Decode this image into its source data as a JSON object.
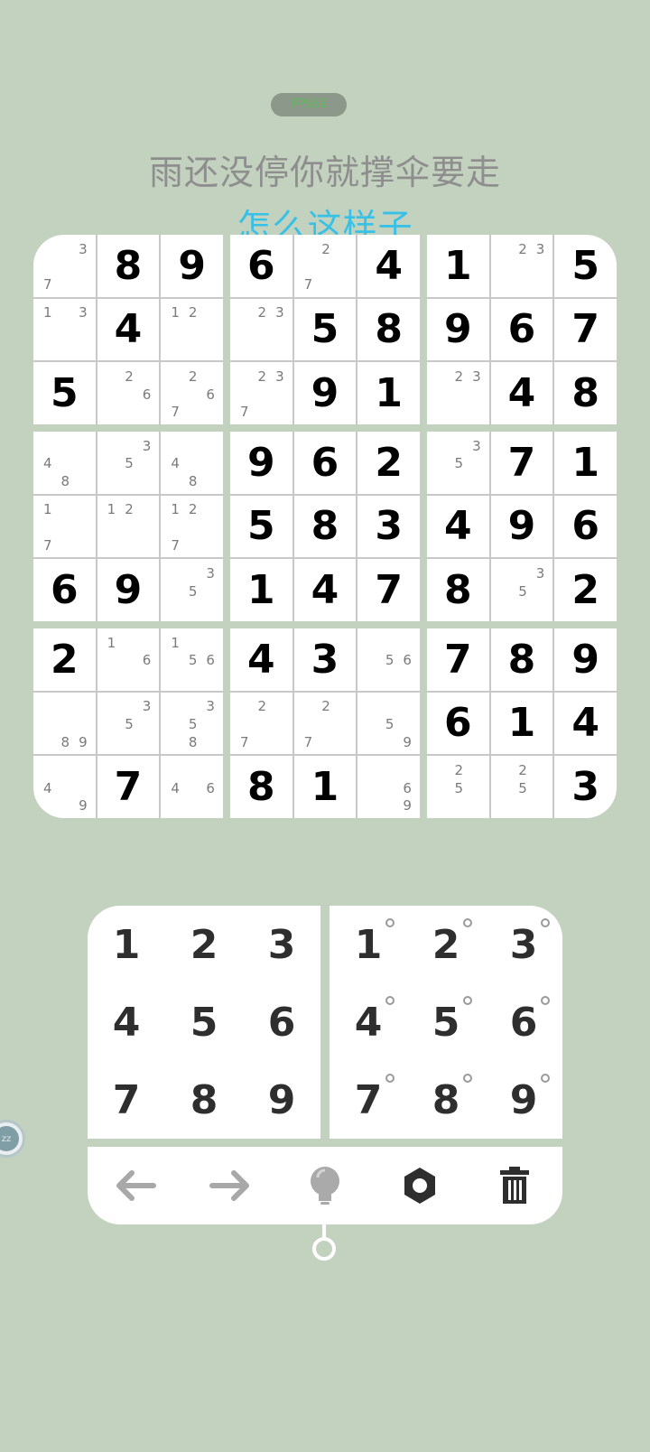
{
  "status": {
    "fps": "FPS61"
  },
  "lyrics": {
    "line1": "雨还没停你就撑伞要走",
    "line2": "怎么这样子"
  },
  "board": {
    "rows": [
      [
        {
          "n": [
            3,
            7
          ]
        },
        {
          "v": "8"
        },
        {
          "v": "9"
        },
        {
          "v": "6"
        },
        {
          "n": [
            2,
            7
          ]
        },
        {
          "v": "4"
        },
        {
          "v": "1"
        },
        {
          "n": [
            2,
            3
          ]
        },
        {
          "v": "5"
        }
      ],
      [
        {
          "n": [
            1,
            3
          ]
        },
        {
          "v": "4"
        },
        {
          "n": [
            1,
            2
          ]
        },
        {
          "n": [
            2,
            3
          ]
        },
        {
          "v": "5"
        },
        {
          "v": "8"
        },
        {
          "v": "9"
        },
        {
          "v": "6"
        },
        {
          "v": "7"
        }
      ],
      [
        {
          "v": "5"
        },
        {
          "n": [
            2,
            6
          ]
        },
        {
          "n": [
            2,
            6,
            7
          ]
        },
        {
          "n": [
            2,
            3,
            7
          ]
        },
        {
          "v": "9"
        },
        {
          "v": "1"
        },
        {
          "n": [
            2,
            3
          ]
        },
        {
          "v": "4"
        },
        {
          "v": "8"
        }
      ],
      [
        {
          "n": [
            4,
            8
          ]
        },
        {
          "n": [
            3,
            5
          ]
        },
        {
          "n": [
            4,
            8
          ]
        },
        {
          "v": "9"
        },
        {
          "v": "6"
        },
        {
          "v": "2"
        },
        {
          "n": [
            3,
            5
          ]
        },
        {
          "v": "7"
        },
        {
          "v": "1"
        }
      ],
      [
        {
          "n": [
            1,
            7
          ]
        },
        {
          "n": [
            1,
            2
          ]
        },
        {
          "n": [
            1,
            2,
            7
          ]
        },
        {
          "v": "5"
        },
        {
          "v": "8"
        },
        {
          "v": "3"
        },
        {
          "v": "4"
        },
        {
          "v": "9"
        },
        {
          "v": "6"
        }
      ],
      [
        {
          "v": "6"
        },
        {
          "v": "9"
        },
        {
          "n": [
            3,
            5
          ]
        },
        {
          "v": "1"
        },
        {
          "v": "4"
        },
        {
          "v": "7"
        },
        {
          "v": "8"
        },
        {
          "n": [
            3,
            5
          ]
        },
        {
          "v": "2"
        }
      ],
      [
        {
          "v": "2"
        },
        {
          "n": [
            1,
            6
          ]
        },
        {
          "n": [
            1,
            5,
            6
          ]
        },
        {
          "v": "4"
        },
        {
          "v": "3"
        },
        {
          "n": [
            5,
            6
          ]
        },
        {
          "v": "7"
        },
        {
          "v": "8"
        },
        {
          "v": "9"
        }
      ],
      [
        {
          "n": [
            8,
            9
          ]
        },
        {
          "n": [
            3,
            5
          ]
        },
        {
          "n": [
            3,
            5,
            8
          ]
        },
        {
          "n": [
            2,
            7
          ]
        },
        {
          "n": [
            2,
            7
          ]
        },
        {
          "n": [
            5,
            9
          ]
        },
        {
          "v": "6"
        },
        {
          "v": "1"
        },
        {
          "v": "4"
        }
      ],
      [
        {
          "n": [
            4,
            9
          ]
        },
        {
          "v": "7"
        },
        {
          "n": [
            4,
            6
          ]
        },
        {
          "v": "8"
        },
        {
          "v": "1"
        },
        {
          "n": [
            6,
            9
          ]
        },
        {
          "n": [
            2,
            5
          ]
        },
        {
          "n": [
            2,
            5
          ]
        },
        {
          "v": "3"
        }
      ]
    ]
  },
  "numpad": {
    "digits": [
      "1",
      "2",
      "3",
      "4",
      "5",
      "6",
      "7",
      "8",
      "9"
    ]
  },
  "notepad": {
    "digits": [
      "1",
      "2",
      "3",
      "4",
      "5",
      "6",
      "7",
      "8",
      "9"
    ]
  },
  "toolbar": {
    "undo": "arrow-left-icon",
    "redo": "arrow-right-icon",
    "hint": "lightbulb-icon",
    "settings": "gear-icon",
    "delete": "trash-icon"
  },
  "side_bubble": {
    "label": "zz"
  },
  "colors": {
    "background": "#c2d2be",
    "accent": "#38c1e6",
    "fps_text": "#5bbd55"
  }
}
